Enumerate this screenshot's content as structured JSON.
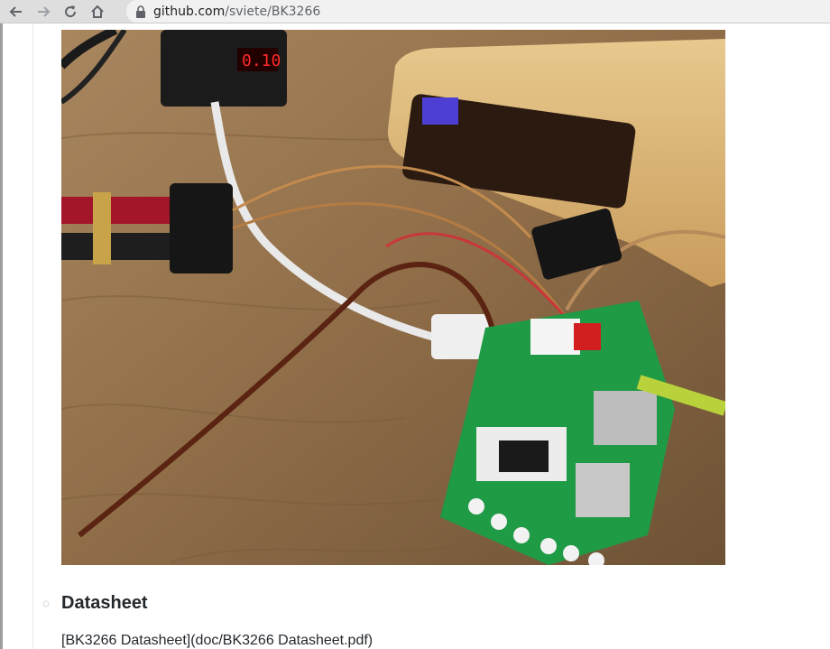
{
  "browser": {
    "url_host": "github.com",
    "url_path": "/sviete/BK3266",
    "icons": [
      "back-arrow-icon",
      "forward-arrow-icon",
      "reload-icon",
      "home-icon",
      "lock-icon"
    ]
  },
  "photo": {
    "display_text": "0.10"
  },
  "content": {
    "heading": "Datasheet",
    "paragraph": "[BK3266 Datasheet](doc/BK3266 Datasheet.pdf)"
  }
}
